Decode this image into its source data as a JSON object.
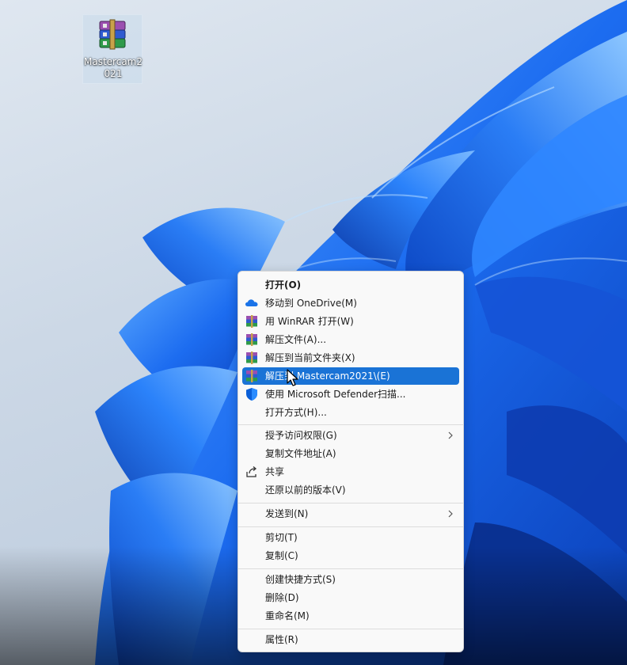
{
  "desktop": {
    "icon_name": "winrar-archive-icon",
    "file_label": "Mastercam2021"
  },
  "context_menu": {
    "items": [
      {
        "label": "打开(O)",
        "icon": "none"
      },
      {
        "label": "移动到 OneDrive(M)",
        "icon": "onedrive-cloud-icon"
      },
      {
        "label": "用 WinRAR 打开(W)",
        "icon": "winrar-icon"
      },
      {
        "label": "解压文件(A)...",
        "icon": "winrar-icon"
      },
      {
        "label": "解压到当前文件夹(X)",
        "icon": "winrar-icon"
      },
      {
        "label": "解压到 Mastercam2021\\(E)",
        "icon": "winrar-icon"
      },
      {
        "label": "使用 Microsoft Defender扫描...",
        "icon": "defender-shield-icon"
      },
      {
        "label": "打开方式(H)...",
        "icon": "none"
      },
      {
        "label": "授予访问权限(G)",
        "icon": "none"
      },
      {
        "label": "复制文件地址(A)",
        "icon": "none"
      },
      {
        "label": "共享",
        "icon": "share-icon"
      },
      {
        "label": "还原以前的版本(V)",
        "icon": "none"
      },
      {
        "label": "发送到(N)",
        "icon": "none"
      },
      {
        "label": "剪切(T)",
        "icon": "none"
      },
      {
        "label": "复制(C)",
        "icon": "none"
      },
      {
        "label": "创建快捷方式(S)",
        "icon": "none"
      },
      {
        "label": "删除(D)",
        "icon": "none"
      },
      {
        "label": "重命名(M)",
        "icon": "none"
      },
      {
        "label": "属性(R)",
        "icon": "none"
      }
    ]
  },
  "colors": {
    "highlight": "#1a73d6",
    "wallpaper_blue": "#1e6ff0",
    "menu_background": "#f9f9f9"
  }
}
